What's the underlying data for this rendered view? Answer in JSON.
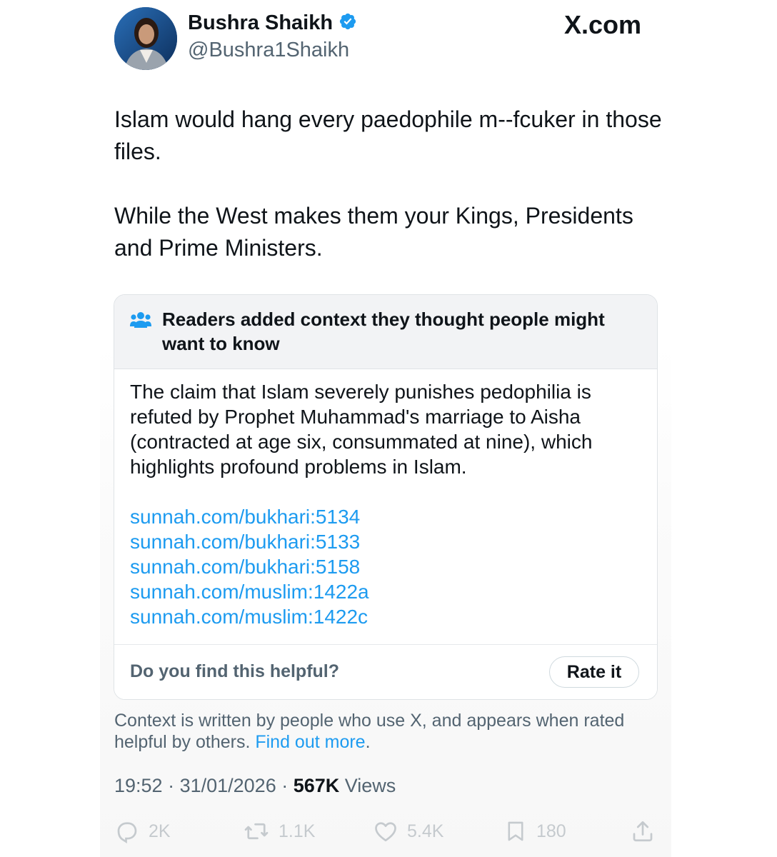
{
  "post": {
    "author": {
      "name": "Bushra Shaikh",
      "handle": "@Bushra1Shaikh",
      "verified": true
    },
    "site": "X.com",
    "text": [
      "Islam would hang every paedophile m--fcuker in those files.",
      "While the West makes them your Kings, Presidents and Prime Ministers."
    ],
    "community_note": {
      "title": "Readers added context they thought people might want to know",
      "body": "The claim that Islam severely punishes pedophilia is refuted by Prophet Muhammad's marriage to Aisha (contracted at age six, consummated at nine), which highlights profound problems in Islam.",
      "links": [
        "sunnah.com/bukhari:5134",
        "sunnah.com/bukhari:5133",
        "sunnah.com/bukhari:5158",
        "sunnah.com/muslim:1422a",
        "sunnah.com/muslim:1422c"
      ],
      "helpful_question": "Do you find this helpful?",
      "rate_button": "Rate it"
    },
    "context_disclaimer": {
      "text": "Context is written by people who use X, and appears when rated helpful by others. ",
      "link": "Find out more",
      "end": "."
    },
    "meta": {
      "time": "19:52",
      "separator": " · ",
      "date": "31/01/2026",
      "views_count": "567K",
      "views_label": " Views"
    },
    "actions": {
      "replies": "2K",
      "reposts": "1.1K",
      "likes": "5.4K",
      "bookmarks": "180"
    },
    "icons": {
      "verified": "verified-badge-icon",
      "people": "people-icon",
      "reply": "reply-icon",
      "repost": "repost-icon",
      "like": "heart-icon",
      "bookmark": "bookmark-icon",
      "share": "share-icon"
    },
    "colors": {
      "link": "#1d9bf0",
      "verified": "#1d9bf0",
      "secondary_text": "#536471",
      "primary_text": "#0f1419",
      "note_header_bg": "#f2f3f5"
    }
  }
}
